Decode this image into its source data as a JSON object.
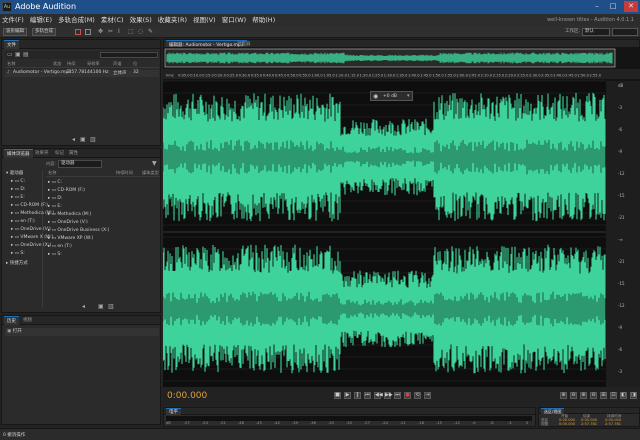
{
  "window": {
    "title": "Adobe Audition",
    "logo_text": "Au",
    "min": "–",
    "max": "□",
    "close": "✕"
  },
  "menu": [
    "文件(F)",
    "编辑(E)",
    "多轨合成(M)",
    "素材(C)",
    "效果(S)",
    "收藏夹(R)",
    "视图(V)",
    "窗口(W)",
    "帮助(H)"
  ],
  "menu_right": "well-known titles - Audition 4.0.1.1",
  "toolbar": {
    "waveform_btn": "波形编辑",
    "multitrack_btn": "多轨合成",
    "workspace_label": "工作区:",
    "workspace_value": "默认"
  },
  "files_panel": {
    "tab": "文件",
    "columns": [
      "名称",
      "状态",
      "持续",
      "采样率",
      "声道",
      "位"
    ],
    "rows": [
      {
        "name": "Audiomotor - Vertigo.mp3",
        "duration": "2:57.781",
        "rate": "44100 Hz",
        "channels": "立体声",
        "bits": "32"
      }
    ]
  },
  "browser_panel": {
    "tabs": [
      "媒体浏览器",
      "效果夹",
      "标记",
      "属性"
    ],
    "location_label": "内容:",
    "location_value": "驱动器",
    "tree_header": "驱动器",
    "tree": [
      "C:",
      "D:",
      "E:",
      "CD-ROM (F:)",
      "Methodica (M:)",
      "en (T:)",
      "OneDrive (V:)",
      "VMware X (W:)",
      "OneDrive (X:)",
      "S:"
    ],
    "shortcut": "快捷方式",
    "list_headers": [
      "名称",
      "持续时间",
      "媒体类型"
    ],
    "list": [
      "C:",
      "CD-ROM (F:)",
      "D:",
      "E:",
      "Methodica (M:)",
      "OneDrive (V:)",
      "OneDrive Business (X:)",
      "VMware XP (W:)",
      "en (T:)",
      "S:"
    ]
  },
  "history_panel": {
    "tabs": [
      "历史",
      "视频"
    ],
    "item": "打开",
    "status": "0 撤消操作"
  },
  "editor": {
    "tabs": [
      "编辑器: Audiomotor - Vertigo.mp3",
      "混音器"
    ],
    "time": "0:00.000",
    "ruler": [
      "hms",
      "0:05.0",
      "0:10.0",
      "0:15.0",
      "0:20.0",
      "0:25.0",
      "0:30.0",
      "0:35.0",
      "0:40.0",
      "0:45.0",
      "0:50.0",
      "0:55.0",
      "1:00.0",
      "1:05.0",
      "1:10.0",
      "1:15.0",
      "1:20.0",
      "1:25.0",
      "1:30.0",
      "1:35.0",
      "1:40.0",
      "1:45.0",
      "1:50.0",
      "1:55.0",
      "2:00.0",
      "2:05.0",
      "2:10.0",
      "2:15.0",
      "2:20.0",
      "2:25.0",
      "2:30.0",
      "2:35.0",
      "2:40.0",
      "2:45.0",
      "2:50.0",
      "2:55.0"
    ],
    "volume": "+0 dB",
    "db_scale": [
      "dB",
      "-3",
      "-6",
      "-9",
      "-12",
      "-15",
      "-21",
      "-∞",
      "-21",
      "-15",
      "-12",
      "-9",
      "-6",
      "-3"
    ],
    "wave_color": "#3ed39a"
  },
  "levels_panel": {
    "tab": "电平",
    "scale": [
      "dB",
      "-57",
      "-54",
      "-51",
      "-48",
      "-45",
      "-42",
      "-39",
      "-36",
      "-33",
      "-30",
      "-27",
      "-24",
      "-21",
      "-18",
      "-15",
      "-12",
      "-9",
      "-6",
      "-3",
      "0"
    ]
  },
  "selection_panel": {
    "tab": "选区/视图",
    "headers": [
      "开始",
      "结束",
      "持续时间"
    ],
    "rows": [
      {
        "label": "选区",
        "start": "0:00.000",
        "end": "0:00.000",
        "dur": "0:00.000"
      },
      {
        "label": "视图",
        "start": "0:00.000",
        "end": "2:57.781",
        "dur": "2:57.781"
      }
    ]
  },
  "status": {
    "left": "0 撤消操作"
  }
}
